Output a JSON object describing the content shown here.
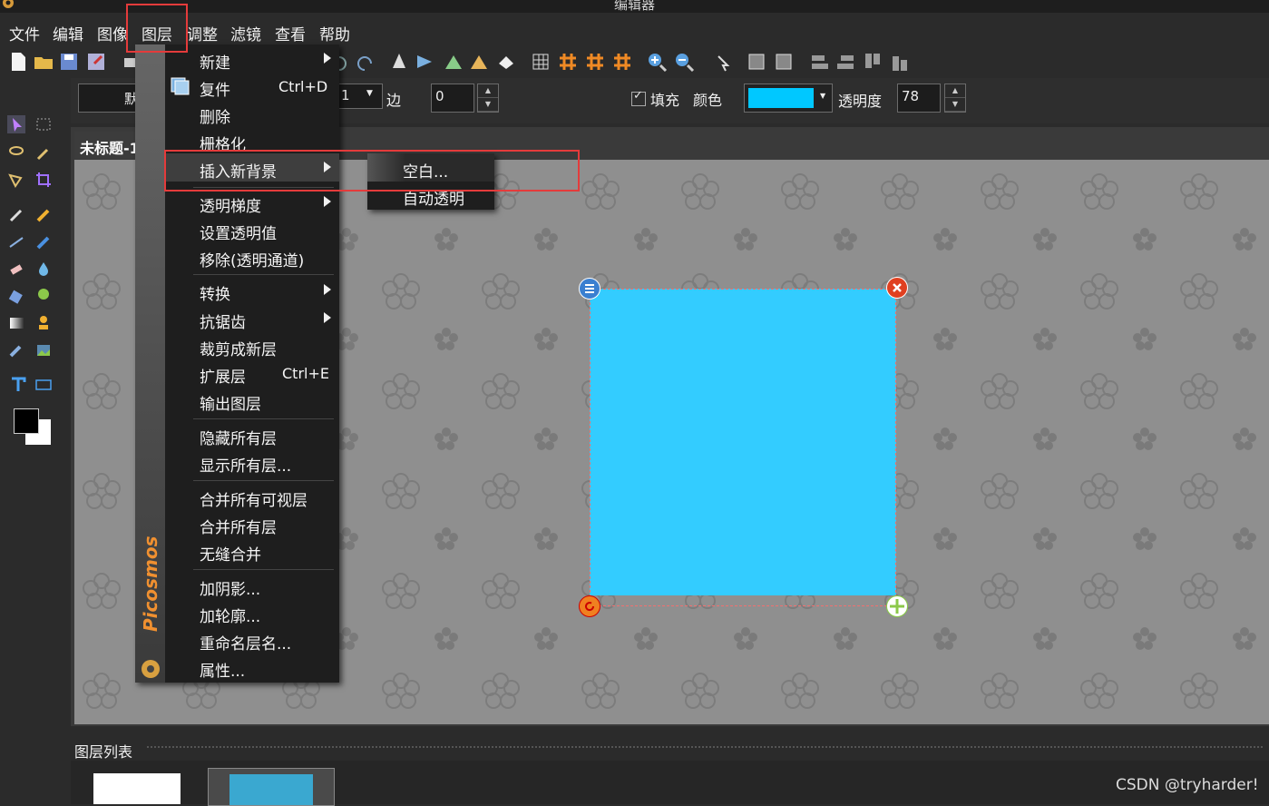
{
  "window": {
    "title": "编辑器"
  },
  "menubar": [
    "文件",
    "编辑",
    "图像",
    "图层",
    "调整",
    "滤镜",
    "查看",
    "帮助"
  ],
  "options": {
    "preset_partial": "默",
    "size_value": "1",
    "edge_label": "边",
    "edge_value": "0",
    "fill_label": "填充",
    "color_label": "颜色",
    "fill_color": "#00c8ff",
    "opacity_label": "透明度",
    "opacity_value": "78"
  },
  "document": {
    "tab_title": "未标题-1",
    "shape_color": "#33ccff"
  },
  "layer_menu": {
    "brand": "Picosmos",
    "items": [
      {
        "label": "新建",
        "submenu": true
      },
      {
        "label": "复件",
        "shortcut": "Ctrl+D"
      },
      {
        "label": "删除"
      },
      {
        "label": "栅格化"
      },
      {
        "label": "插入新背景",
        "submenu": true,
        "highlighted": true
      },
      {
        "label": "透明梯度",
        "submenu": true
      },
      {
        "label": "设置透明值"
      },
      {
        "label": "移除(透明通道)"
      },
      {
        "label": "转换",
        "submenu": true
      },
      {
        "label": "抗锯齿",
        "submenu": true
      },
      {
        "label": "裁剪成新层"
      },
      {
        "label": "扩展层",
        "shortcut": "Ctrl+E"
      },
      {
        "label": "输出图层"
      },
      {
        "label": "隐藏所有层"
      },
      {
        "label": "显示所有层..."
      },
      {
        "label": "合并所有可视层"
      },
      {
        "label": "合并所有层"
      },
      {
        "label": "无缝合并"
      },
      {
        "label": "加阴影..."
      },
      {
        "label": "加轮廓..."
      },
      {
        "label": "重命名层名..."
      },
      {
        "label": "属性..."
      }
    ]
  },
  "submenu": {
    "items": [
      "空白...",
      "自动透明"
    ]
  },
  "layers_panel": {
    "title": "图层列表"
  },
  "watermark": "CSDN @tryharder!"
}
